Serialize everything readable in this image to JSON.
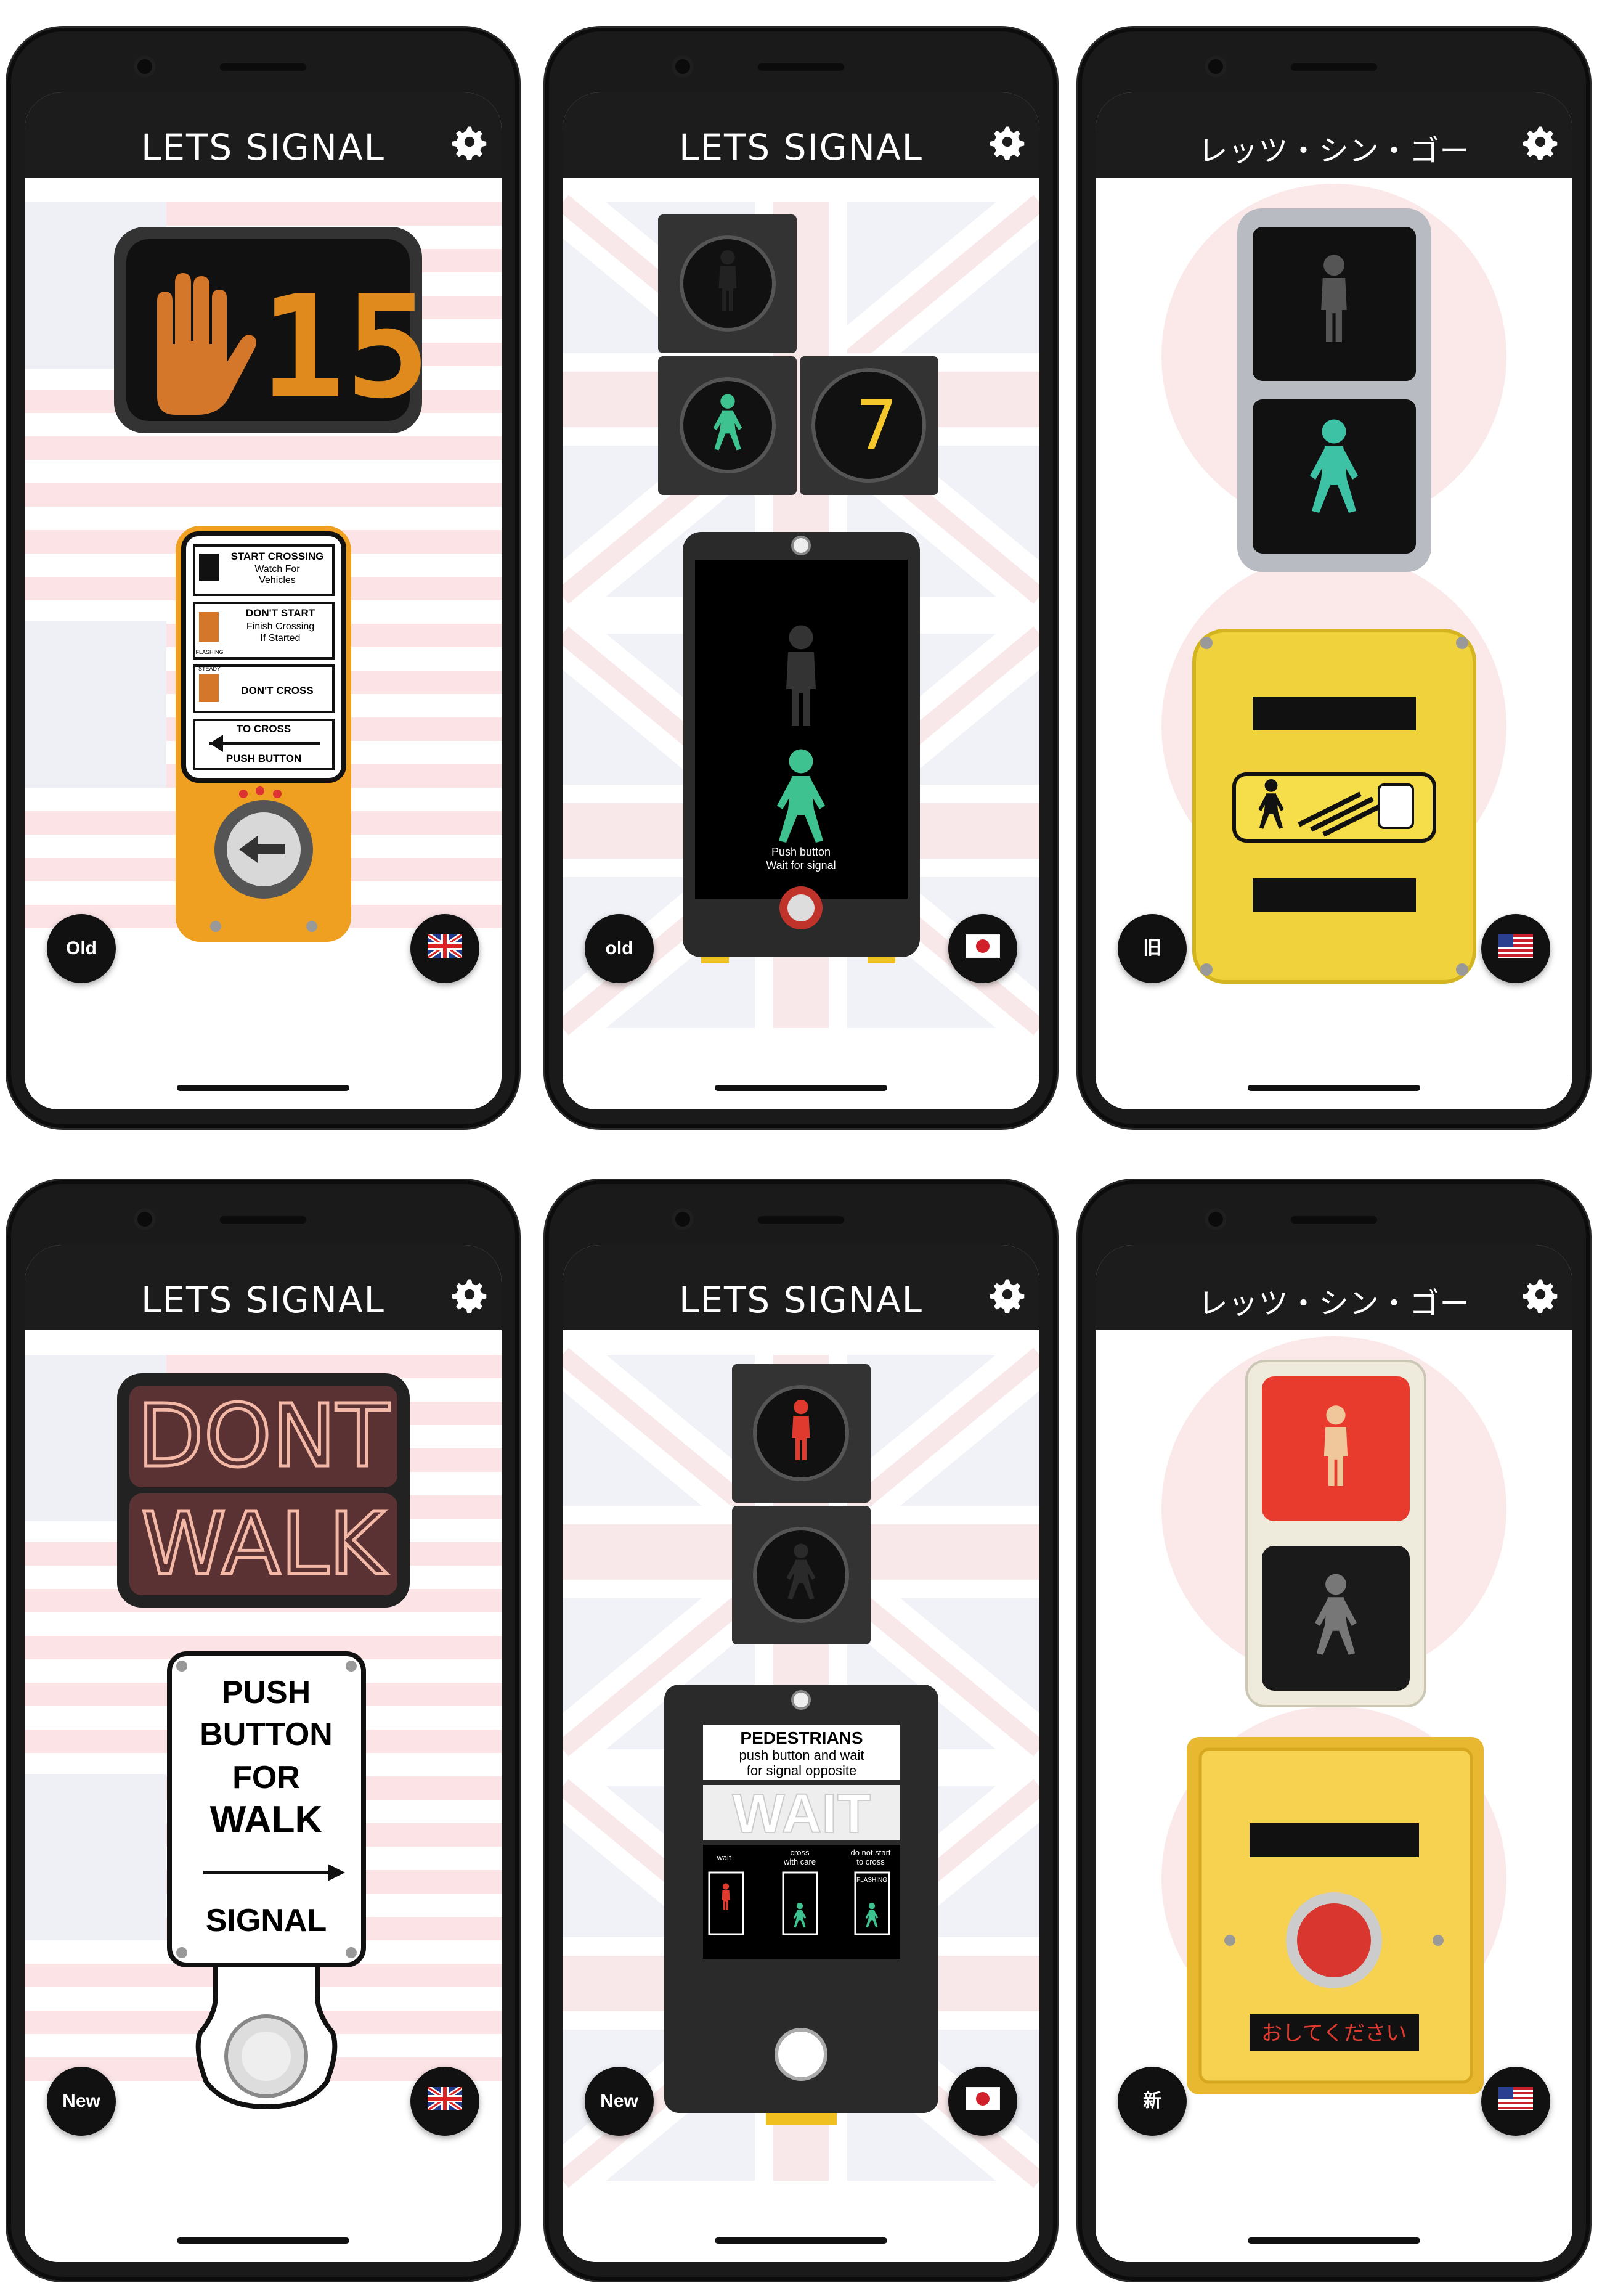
{
  "screens": [
    {
      "title": "LETS SIGNAL",
      "left_button": "Old",
      "flag": "uk-flag-icon",
      "countdown": "15",
      "sign": {
        "l1": "START CROSSING",
        "l2": "Watch For",
        "l3": "Vehicles",
        "l4": "DON'T START",
        "l5": "Finish Crossing",
        "l6": "If Started",
        "l7": "FLASHING",
        "l8": "STEADY",
        "l9": "DON'T CROSS",
        "l10": "TO CROSS",
        "l11": "PUSH BUTTON"
      }
    },
    {
      "title": "LETS SIGNAL",
      "left_button": "old",
      "flag": "japan-flag-icon",
      "countdown": "7",
      "box": {
        "l1": "Push button",
        "l2": "Wait for signal"
      }
    },
    {
      "title": "レッツ・シン・ゴー",
      "left_button": "旧",
      "flag": "us-flag-icon"
    },
    {
      "title": "LETS SIGNAL",
      "left_button": "New",
      "flag": "uk-flag-icon",
      "neon": {
        "l1": "DONT",
        "l2": "WALK"
      },
      "sign": {
        "l1": "PUSH",
        "l2": "BUTTON",
        "l3": "FOR",
        "l4": "WALK",
        "l5": "SIGNAL"
      }
    },
    {
      "title": "LETS SIGNAL",
      "left_button": "New",
      "flag": "japan-flag-icon",
      "box": {
        "l1": "PEDESTRIANS",
        "l2": "push button and wait",
        "l3": "for signal opposite",
        "l4": "WAIT",
        "l5": "wait",
        "l6": "cross",
        "l7": "with care",
        "l8": "do not start",
        "l9": "to cross",
        "l10": "FLASHING"
      }
    },
    {
      "title": "レッツ・シン・ゴー",
      "left_button": "新",
      "flag": "us-flag-icon",
      "box": {
        "l1": "おしてください"
      }
    }
  ],
  "colors": {
    "appbar": "#1c1c1c",
    "amber": "#e08a1e",
    "green": "#3ec28f",
    "red": "#e03a2e",
    "yellow": "#f0d23c"
  }
}
